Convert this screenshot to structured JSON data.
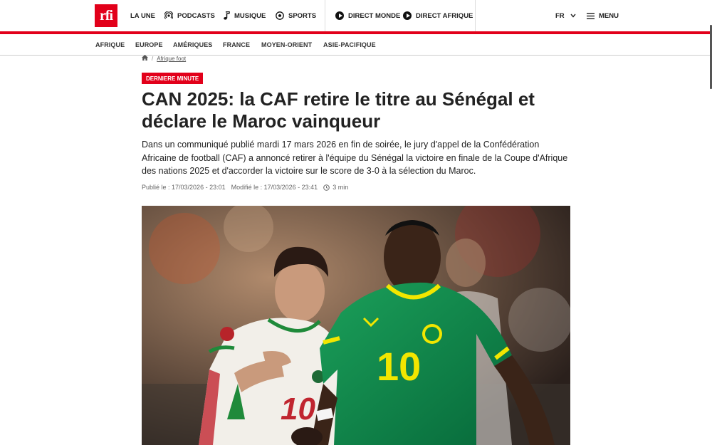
{
  "header": {
    "logo_text": "rfi",
    "nav": [
      {
        "label": "LA UNE",
        "icon": "home-icon"
      },
      {
        "label": "PODCASTS",
        "icon": "podcast-icon"
      },
      {
        "label": "MUSIQUE",
        "icon": "music-note-icon"
      },
      {
        "label": "SPORTS",
        "icon": "soccer-ball-icon"
      }
    ],
    "live": [
      {
        "label": "DIRECT MONDE",
        "icon": "play-circle-icon"
      },
      {
        "label": "DIRECT AFRIQUE",
        "icon": "play-circle-icon"
      }
    ],
    "language": "FR",
    "menu_label": "MENU"
  },
  "subnav": {
    "items": [
      "AFRIQUE",
      "EUROPE",
      "AMÉRIQUES",
      "FRANCE",
      "MOYEN-ORIENT",
      "ASIE-PACIFIQUE"
    ]
  },
  "breadcrumb": {
    "separator": "/",
    "current": "Afrique foot"
  },
  "article": {
    "badge": "DERNIERE MINUTE",
    "title": "CAN 2025: la CAF retire le titre au Sénégal et déclare le Maroc vainqueur",
    "lead": "Dans un communiqué publié mardi 17 mars 2026 en fin de soirée, le jury d'appel de la Confédération Africaine de football (CAF) a annoncé retirer à l'équipe du Sénégal la victoire en finale de la Coupe d'Afrique des nations 2025 et d'accorder la victoire sur le score de 3-0 à la sélection du Maroc.",
    "published": "Publié le : 17/03/2026 - 23:01",
    "modified": "Modifié le : 17/03/2026 - 23:41",
    "read_time": "3 min",
    "image_jersey_left": "10",
    "image_jersey_right": "10"
  },
  "colors": {
    "brand_red": "#e2001a",
    "senegal_green": "#0d8a44",
    "senegal_yellow": "#f2e600"
  }
}
